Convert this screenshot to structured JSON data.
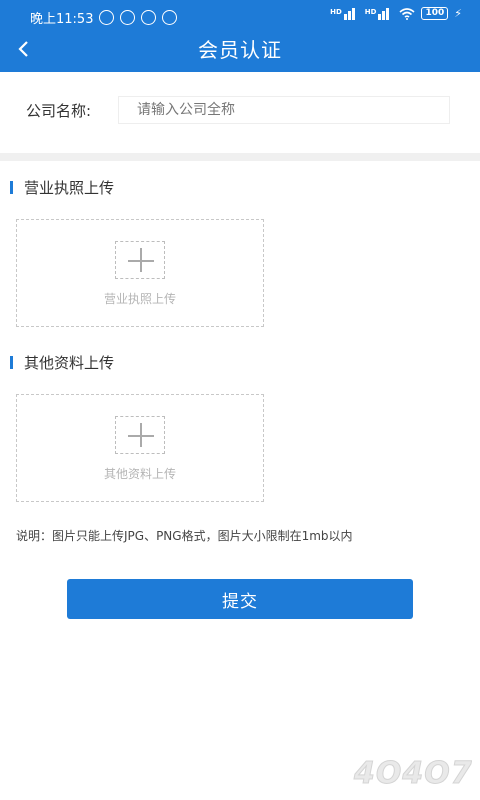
{
  "status_bar": {
    "time": "晚上11:53",
    "network_tags": [
      "HD",
      "HD"
    ],
    "battery": "100"
  },
  "header": {
    "title": "会员认证",
    "back_icon": "chevron-left-icon",
    "background_color": "#1e7bd7"
  },
  "company": {
    "label": "公司名称:",
    "placeholder": "请输入公司全称",
    "value": ""
  },
  "sections": [
    {
      "title": "营业执照上传",
      "upload_label": "营业执照上传",
      "icon": "plus-icon"
    },
    {
      "title": "其他资料上传",
      "upload_label": "其他资料上传",
      "icon": "plus-icon"
    }
  ],
  "note": "说明：图片只能上传JPG、PNG格式，图片大小限制在1mb以内",
  "submit_label": "提交",
  "watermark": "4O4O7"
}
